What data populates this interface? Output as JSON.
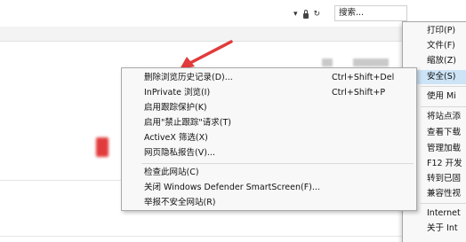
{
  "toolbar": {
    "dropdown_glyph": "▾",
    "refresh_glyph": "↻",
    "search_placeholder": "搜索..."
  },
  "tools_menu": {
    "items": [
      {
        "label": "打印(P)",
        "highlight": false
      },
      {
        "label": "文件(F)",
        "highlight": false
      },
      {
        "label": "缩放(Z)",
        "highlight": false
      },
      {
        "label": "安全(S)",
        "highlight": true
      },
      {
        "label": "使用 Mi",
        "highlight": false
      },
      {
        "label": "将站点添",
        "highlight": false
      },
      {
        "label": "查看下载",
        "highlight": false
      },
      {
        "label": "管理加载",
        "highlight": false
      },
      {
        "label": "F12 开发",
        "highlight": false
      },
      {
        "label": "转到已固",
        "highlight": false
      },
      {
        "label": "兼容性视",
        "highlight": false
      },
      {
        "label": "Internet",
        "highlight": false
      },
      {
        "label": "关于 Int",
        "highlight": false
      }
    ]
  },
  "safety_menu": {
    "items": [
      {
        "label": "删除浏览历史记录(D)...",
        "shortcut": "Ctrl+Shift+Del"
      },
      {
        "label": "InPrivate 浏览(I)",
        "shortcut": "Ctrl+Shift+P"
      },
      {
        "label": "启用跟踪保护(K)",
        "shortcut": ""
      },
      {
        "label": "启用\"禁止跟踪\"请求(T)",
        "shortcut": ""
      },
      {
        "label": "ActiveX 筛选(X)",
        "shortcut": ""
      },
      {
        "label": "网页隐私报告(V)...",
        "shortcut": ""
      },
      {
        "label": "检查此网站(C)",
        "shortcut": ""
      },
      {
        "label": "关闭 Windows Defender SmartScreen(F)...",
        "shortcut": ""
      },
      {
        "label": "举报不安全网站(R)",
        "shortcut": ""
      }
    ]
  },
  "colors": {
    "arrow": "#e23b3b",
    "highlight": "#cde4f7"
  }
}
